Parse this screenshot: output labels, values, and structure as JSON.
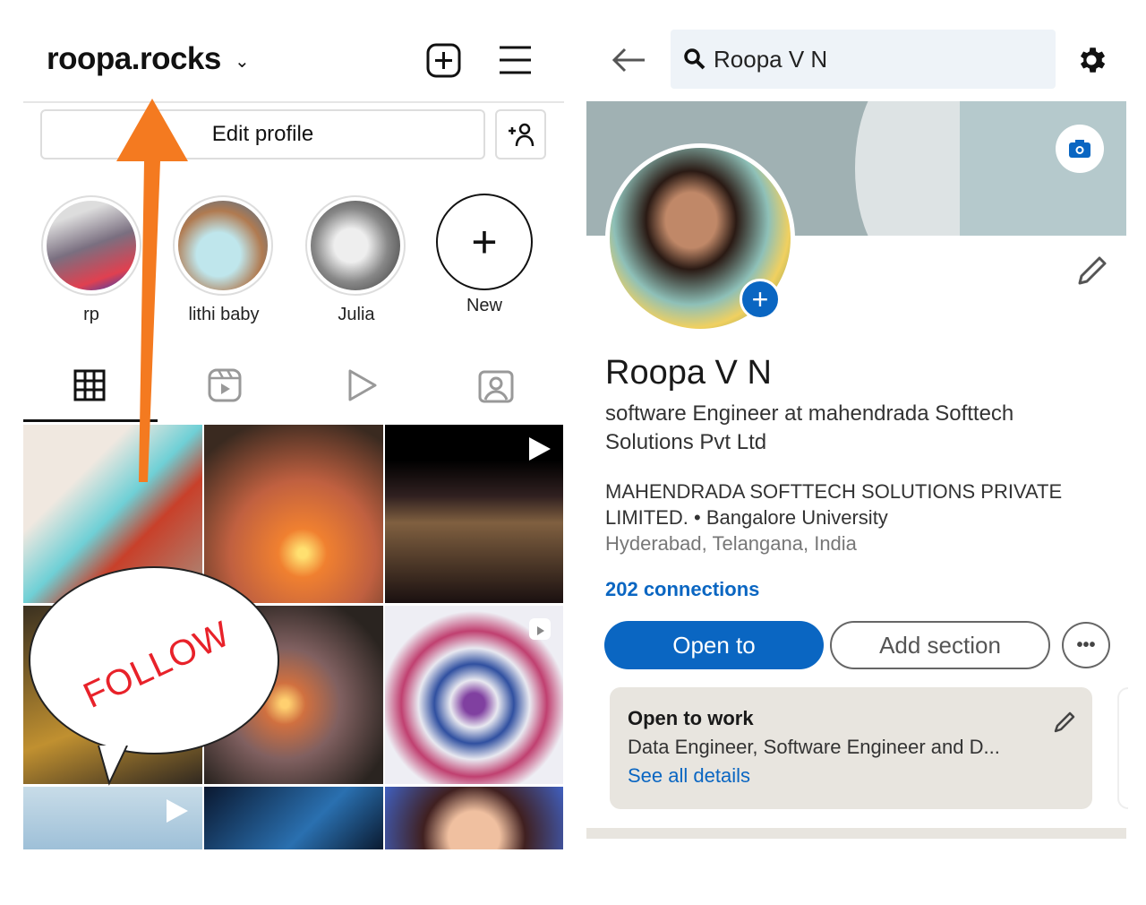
{
  "instagram": {
    "username": "roopa.rocks",
    "edit_profile": "Edit profile",
    "highlights": [
      {
        "label": "rp"
      },
      {
        "label": "lithi baby"
      },
      {
        "label": "Julia"
      },
      {
        "label": "New"
      }
    ],
    "tabs": [
      "grid-icon",
      "reels-icon",
      "video-icon",
      "tagged-icon"
    ],
    "annotation": "FOLLOW"
  },
  "linkedin": {
    "search_value": "Roopa V N",
    "name": "Roopa V N",
    "headline": "software Engineer at mahendrada Softtech Solutions Pvt Ltd",
    "company_edu": "MAHENDRADA SOFTTECH SOLUTIONS PRIVATE LIMITED. • Bangalore University",
    "location": "Hyderabad, Telangana, India",
    "connections": "202 connections",
    "open_to": "Open to",
    "add_section": "Add section",
    "more": "•••",
    "open_to_work": {
      "title": "Open to work",
      "roles": "Data Engineer, Software Engineer and D...",
      "link": "See all details"
    }
  },
  "colors": {
    "accent": "#0a66c2",
    "arrow": "#f47a20",
    "follow": "#e8222a"
  }
}
